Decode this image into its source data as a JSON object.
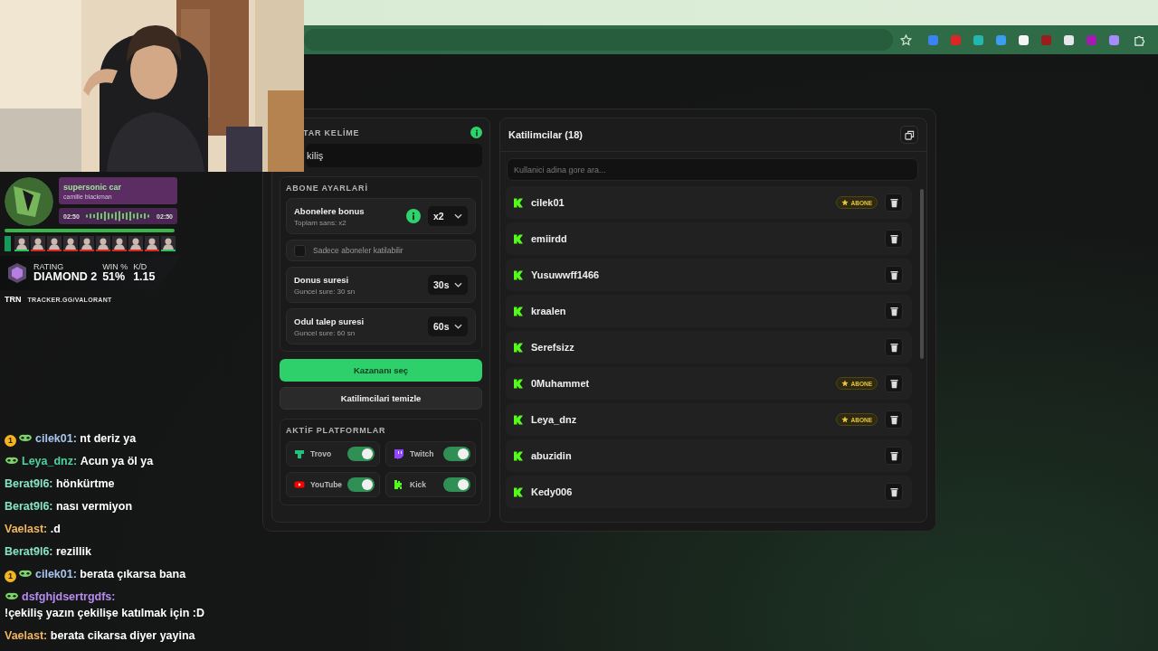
{
  "browser": {
    "extensions": [
      {
        "color": "#3b82f6"
      },
      {
        "color": "#dc2626"
      },
      {
        "color": "#22b8b0"
      },
      {
        "color": "#3b9cf0"
      },
      {
        "color": "#f5f5f5"
      },
      {
        "color": "#9b1c1c"
      },
      {
        "color": "#e5e7eb"
      },
      {
        "color": "#a21caf"
      },
      {
        "color": "#a78bfa"
      }
    ]
  },
  "music": {
    "title": "supersonic car",
    "artist": "camille blackman",
    "elapsed": "02:50",
    "total": "02:50",
    "level": 1
  },
  "agents": [
    {
      "color": "#22c55e"
    },
    {
      "color": "#dc2626"
    },
    {
      "color": "#dc2626"
    },
    {
      "color": "#dc2626"
    },
    {
      "color": "#dc2626"
    },
    {
      "color": "#dc2626"
    },
    {
      "color": "#dc2626"
    },
    {
      "color": "#dc2626"
    },
    {
      "color": "#dc2626"
    },
    {
      "color": "#22c55e"
    }
  ],
  "rank": {
    "rating_label": "RATING",
    "rating": "DIAMOND 2",
    "win_label": "WIN %",
    "win": "51%",
    "kd_label": "K/D",
    "kd": "1.15",
    "brand": "TRN",
    "site": "TRACKER.GG/VALORANT"
  },
  "chat": [
    {
      "badges": [
        {
          "kind": "tier",
          "label": "1"
        },
        {
          "kind": "mask"
        }
      ],
      "user": "cilek01:",
      "color": "#a9c6ee",
      "text": "nt deriz ya"
    },
    {
      "badges": [
        {
          "kind": "mask"
        }
      ],
      "user": "Leya_dnz:",
      "color": "#4fd1a0",
      "text": "Acun ya öl ya"
    },
    {
      "user": "Berat9l6:",
      "color": "#86e3c4",
      "text": "hönkürtme"
    },
    {
      "user": "Berat9l6:",
      "color": "#86e3c4",
      "text": "nası vermiyon"
    },
    {
      "user": "Vaelast:",
      "color": "#f2b661",
      "text": ".d"
    },
    {
      "user": "Berat9l6:",
      "color": "#86e3c4",
      "text": "rezillik"
    },
    {
      "badges": [
        {
          "kind": "tier",
          "label": "1"
        },
        {
          "kind": "mask"
        }
      ],
      "user": "cilek01:",
      "color": "#a9c6ee",
      "text": "berata çıkarsa bana"
    },
    {
      "badges": [
        {
          "kind": "mask"
        }
      ],
      "user": "dsfghjdsertrgdfs:",
      "color": "#b68cf0",
      "text": "!çekiliş yazın çekilişe katılmak için :D"
    },
    {
      "user": "Vaelast:",
      "color": "#f2b661",
      "text": "berata cikarsa diyer yayina"
    }
  ],
  "keyword": {
    "label": "TAR KELİME",
    "value": "kiliş"
  },
  "subscriber_settings": {
    "title": "ABONE AYARLARİ",
    "items": [
      {
        "kind": "select",
        "label": "Abonelere bonus",
        "hint": "Toplam sans: x2",
        "info": true,
        "value": "x2"
      },
      {
        "kind": "checkbox",
        "label": "Sadece aboneler katilabilir",
        "checked": false
      },
      {
        "kind": "select",
        "label": "Donus suresi",
        "hint": "Guncel sure: 30 sn",
        "info": false,
        "value": "30s"
      },
      {
        "kind": "select",
        "label": "Odul talep suresi",
        "hint": "Guncel sure: 60 sn",
        "info": false,
        "value": "60s"
      }
    ]
  },
  "buttons": [
    {
      "label": "Kazananı seç",
      "kind": "primary"
    },
    {
      "label": "Katilimcilari temizle",
      "kind": "secondary"
    }
  ],
  "platforms": {
    "title": "AKTİF PLATFORMLAR",
    "items": [
      {
        "kind": "trovo",
        "name": "Trovo",
        "on": true
      },
      {
        "kind": "twitch",
        "name": "Twitch",
        "on": true
      },
      {
        "kind": "youtube",
        "name": "YouTube",
        "on": true
      },
      {
        "kind": "kick",
        "name": "Kick",
        "on": true
      }
    ]
  },
  "participants": {
    "title": "Katilimcilar (18)",
    "search_placeholder": "Kullanici adina gore ara...",
    "rows": [
      {
        "name": "cilek01",
        "badge": "ABONE"
      },
      {
        "name": "emiirdd"
      },
      {
        "name": "Yusuwwff1466"
      },
      {
        "name": "kraalen"
      },
      {
        "name": "Serefsizz"
      },
      {
        "name": "0Muhammet",
        "badge": "ABONE"
      },
      {
        "name": "Leya_dnz",
        "badge": "ABONE"
      },
      {
        "name": "abuzidin"
      },
      {
        "name": "Kedy006"
      }
    ]
  }
}
